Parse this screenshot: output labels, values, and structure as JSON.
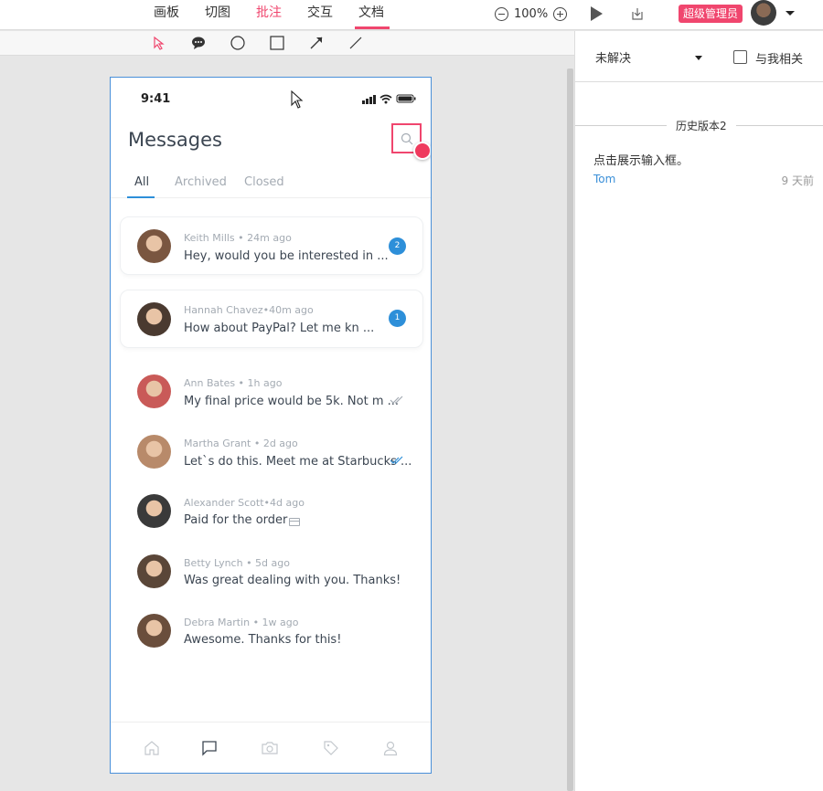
{
  "topbar": {
    "nav": [
      "画板",
      "切图",
      "批注",
      "交互",
      "文档"
    ],
    "active_nav": 2,
    "zoom": "100%",
    "role_badge": "超级管理员"
  },
  "right_panel": {
    "filter": "未解决",
    "checkbox_label": "与我相关",
    "version_label": "历史版本2",
    "comment": {
      "text": "点击展示输入框。",
      "author": "Tom",
      "time": "9 天前"
    }
  },
  "phone": {
    "status_time": "9:41",
    "title": "Messages",
    "tabs": [
      "All",
      "Archived",
      "Closed"
    ],
    "messages": [
      {
        "meta": "Keith Mills • 24m ago",
        "text": "Hey, would you be interested in ...",
        "badge": "2",
        "status": "unread",
        "avatar_color": "#7a5640"
      },
      {
        "meta": "Hannah Chavez•40m ago",
        "text": "How about PayPal? Let me kn ...",
        "badge": "1",
        "status": "unread",
        "avatar_color": "#4a3a30"
      },
      {
        "meta": "Ann Bates • 1h ago",
        "text": "My final price would be 5k. Not m ...",
        "badge": "",
        "status": "read-gray",
        "avatar_color": "#c95a58"
      },
      {
        "meta": "Martha Grant • 2d ago",
        "text": "Let`s do this. Meet me at Starbucks ...",
        "badge": "",
        "status": "read-blue",
        "avatar_color": "#b88a6a"
      },
      {
        "meta": "Alexander Scott•4d ago",
        "text": "Paid for the order",
        "badge": "",
        "status": "attachment",
        "avatar_color": "#3a3a3a"
      },
      {
        "meta": "Betty Lynch • 5d ago",
        "text": "Was great dealing with you. Thanks!",
        "badge": "",
        "status": "none",
        "avatar_color": "#5a4638"
      },
      {
        "meta": "Debra Martin • 1w ago",
        "text": "Awesome. Thanks for this!",
        "badge": "",
        "status": "none",
        "avatar_color": "#6a4e3c"
      }
    ]
  },
  "colors": {
    "accent": "#f0466e",
    "blue": "#2d8fd9",
    "text": "#3c4652",
    "muted": "#a4abb3"
  }
}
